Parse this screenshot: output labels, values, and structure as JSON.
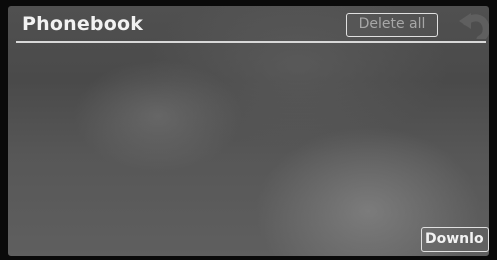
{
  "header": {
    "title": "Phonebook",
    "delete_all_label": "Delete all",
    "back_icon": "back-arrow-icon"
  },
  "footer": {
    "download_label": "Downlo"
  },
  "colors": {
    "screen_background": "#535353",
    "text_active": "#f2f2f2",
    "text_disabled": "#a7a7a7",
    "border": "#e0e0e0"
  }
}
